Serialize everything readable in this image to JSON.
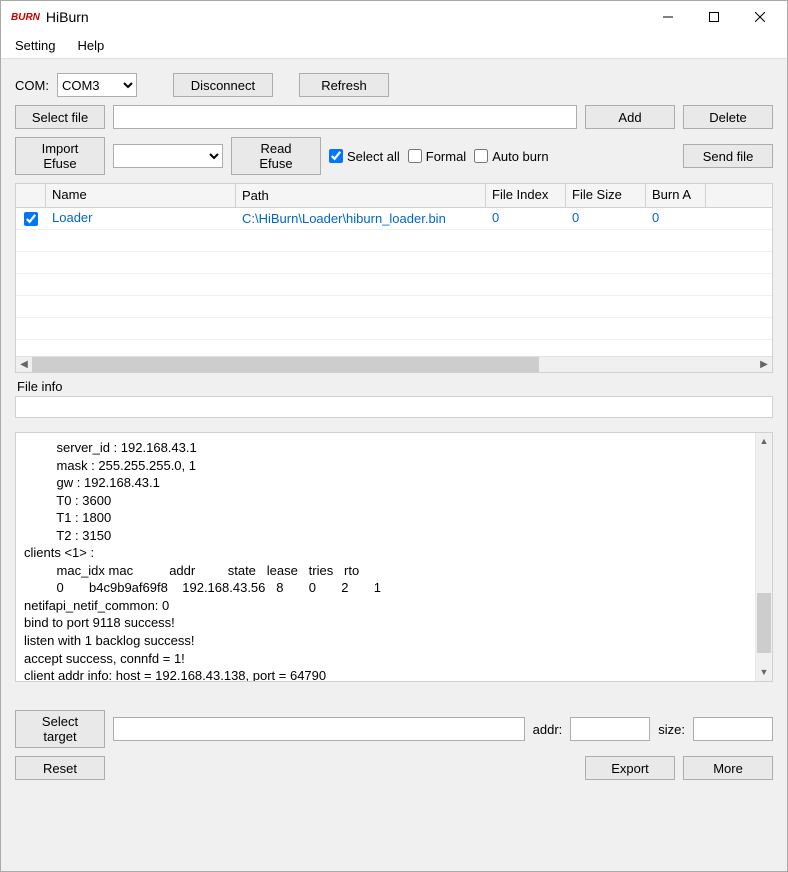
{
  "window": {
    "title": "HiBurn",
    "logo": "BURN"
  },
  "menu": {
    "setting": "Setting",
    "help": "Help"
  },
  "com": {
    "label": "COM:",
    "selected": "COM3",
    "disconnect": "Disconnect",
    "refresh": "Refresh"
  },
  "fileops": {
    "select_file": "Select file",
    "path": "",
    "add": "Add",
    "delete": "Delete",
    "import_efuse": "Import Efuse",
    "efuse_selected": "",
    "read_efuse": "Read Efuse",
    "select_all": "Select all",
    "select_all_checked": true,
    "formal": "Formal",
    "formal_checked": false,
    "auto_burn": "Auto burn",
    "auto_burn_checked": false,
    "send_file": "Send file"
  },
  "table": {
    "headers": {
      "name": "Name",
      "path": "Path",
      "file_index": "File Index",
      "file_size": "File Size",
      "burn_addr": "Burn A"
    },
    "rows": [
      {
        "checked": true,
        "name": "Loader",
        "path": "C:\\HiBurn\\Loader\\hiburn_loader.bin",
        "file_index": "0",
        "file_size": "0",
        "burn_addr": "0"
      }
    ]
  },
  "fileinfo": {
    "label": "File info",
    "value": ""
  },
  "log": {
    "text": "         server_id : 192.168.43.1\n         mask : 255.255.255.0, 1\n         gw : 192.168.43.1\n         T0 : 3600\n         T1 : 1800\n         T2 : 3150\nclients <1> :\n         mac_idx mac          addr         state   lease   tries   rto\n         0       b4c9b9af69f8    192.168.43.56   8       0       2       1\nnetifapi_netif_common: 0\nbind to port 9118 success!\nlisten with 1 backlog success!\naccept success, connfd = 1!\nclient addr info: host = 192.168.43.138, port = 64790"
  },
  "bottom": {
    "select_target": "Select target",
    "target_value": "",
    "addr_label": "addr:",
    "addr_value": "",
    "size_label": "size:",
    "size_value": "",
    "reset": "Reset",
    "export": "Export",
    "more": "More"
  }
}
